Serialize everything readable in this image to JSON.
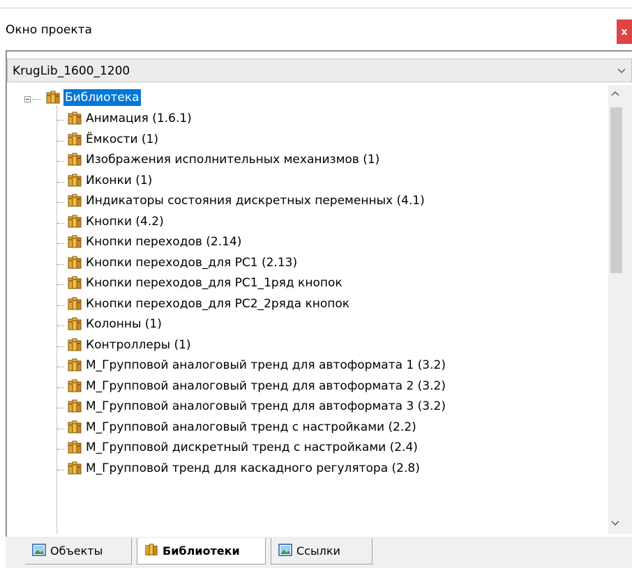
{
  "panel": {
    "title": "Окно проекта",
    "close_label": "x"
  },
  "combo": {
    "value": "KrugLib_1600_1200"
  },
  "tree": {
    "root": {
      "label": "Библиотека"
    },
    "children": [
      "Анимация (1.6.1)",
      "Ёмкости (1)",
      "Изображения исполнительных механизмов (1)",
      "Иконки (1)",
      "Индикаторы состояния дискретных переменных (4.1)",
      "Кнопки (4.2)",
      "Кнопки переходов (2.14)",
      "Кнопки переходов_для PC1 (2.13)",
      "Кнопки переходов_для PC1_1ряд кнопок",
      "Кнопки переходов_для PC2_2ряда кнопок",
      "Колонны (1)",
      "Контроллеры (1)",
      "М_Групповой аналоговый тренд для автоформата 1 (3.2)",
      "М_Групповой аналоговый тренд для автоформата 2 (3.2)",
      "М_Групповой аналоговый тренд для автоформата 3 (3.2)",
      "М_Групповой аналоговый тренд с настройками (2.2)",
      "М_Групповой дискретный тренд с настройками (2.4)",
      "М_Групповой тренд для каскадного регулятора (2.8)"
    ]
  },
  "tabs": [
    {
      "label": "Объекты",
      "icon": "objects-icon",
      "active": false
    },
    {
      "label": "Библиотеки",
      "icon": "library-icon",
      "active": true
    },
    {
      "label": "Ссылки",
      "icon": "links-icon",
      "active": false
    }
  ],
  "colors": {
    "selection": "#0078d7",
    "close": "#e04343",
    "book": "#e2a72e"
  }
}
